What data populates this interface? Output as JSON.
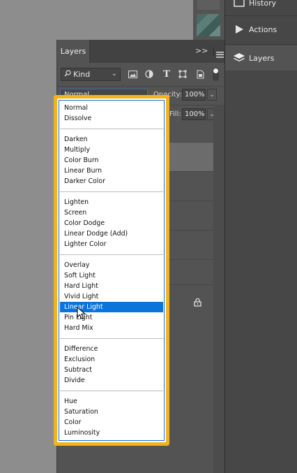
{
  "dock": {
    "items": [
      {
        "label": "History",
        "icon": "history-icon"
      },
      {
        "label": "Actions",
        "icon": "play-icon"
      },
      {
        "label": "Layers",
        "icon": "layers-icon"
      }
    ]
  },
  "layers_panel": {
    "tab_label": "Layers",
    "kind_label": "Kind",
    "blend_mode_value": "Normal",
    "opacity_label": "Opacity:",
    "opacity_value": "100%",
    "fill_label": "Fill:",
    "fill_value": "100%"
  },
  "blend_menu": {
    "selected": "Linear Light",
    "groups": [
      [
        "Normal",
        "Dissolve"
      ],
      [
        "Darken",
        "Multiply",
        "Color Burn",
        "Linear Burn",
        "Darker Color"
      ],
      [
        "Lighten",
        "Screen",
        "Color Dodge",
        "Linear Dodge (Add)",
        "Lighter Color"
      ],
      [
        "Overlay",
        "Soft Light",
        "Hard Light",
        "Vivid Light",
        "Linear Light",
        "Pin Light",
        "Hard Mix"
      ],
      [
        "Difference",
        "Exclusion",
        "Subtract",
        "Divide"
      ],
      [
        "Hue",
        "Saturation",
        "Color",
        "Luminosity"
      ]
    ]
  },
  "colors": {
    "highlight_frame": "#f2b31d",
    "menu_selection": "#0a74db",
    "panel_bg": "#535353"
  }
}
